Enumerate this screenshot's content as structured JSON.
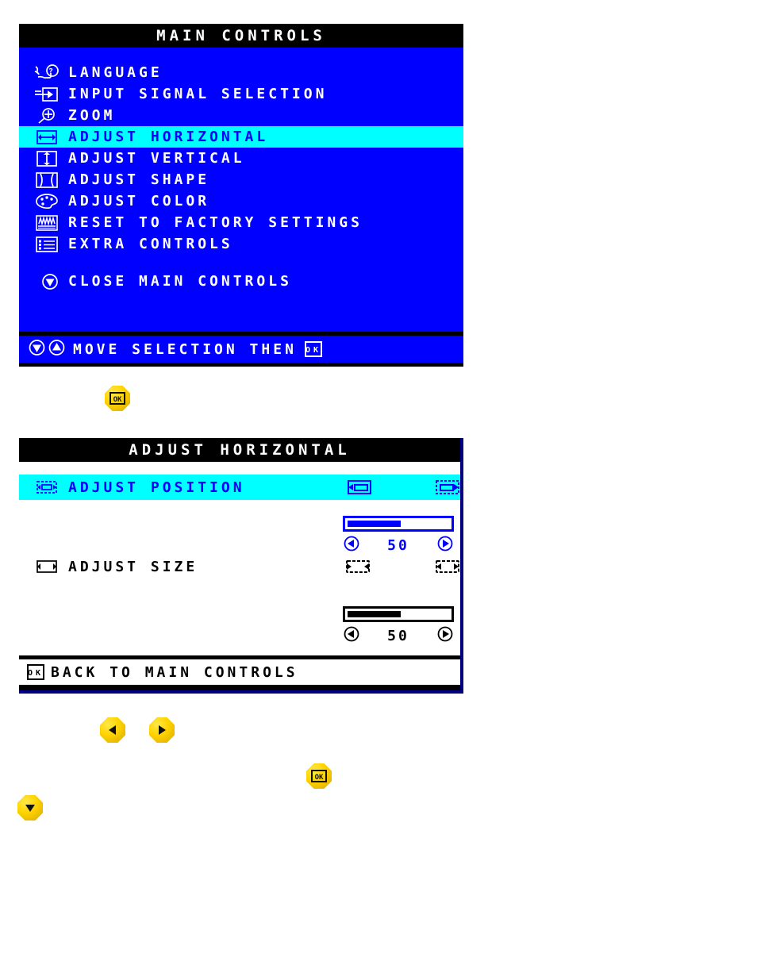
{
  "main_controls": {
    "title": "MAIN CONTROLS",
    "items": [
      {
        "icon": "language-hand-question-icon",
        "label": "LANGUAGE",
        "selected": false
      },
      {
        "icon": "input-signal-arrow-icon",
        "label": "INPUT SIGNAL SELECTION",
        "selected": false
      },
      {
        "icon": "zoom-magnifier-icon",
        "label": "ZOOM",
        "selected": false
      },
      {
        "icon": "adjust-horizontal-icon",
        "label": "ADJUST HORIZONTAL",
        "selected": true
      },
      {
        "icon": "adjust-vertical-icon",
        "label": "ADJUST VERTICAL",
        "selected": false
      },
      {
        "icon": "adjust-shape-icon",
        "label": "ADJUST SHAPE",
        "selected": false
      },
      {
        "icon": "adjust-color-palette-icon",
        "label": "ADJUST COLOR",
        "selected": false
      },
      {
        "icon": "reset-factory-icon",
        "label": "RESET TO FACTORY SETTINGS",
        "selected": false
      },
      {
        "icon": "extra-controls-list-icon",
        "label": "EXTRA CONTROLS",
        "selected": false
      }
    ],
    "close_item": {
      "icon": "down-arrow-circle-icon",
      "label": "CLOSE MAIN CONTROLS"
    },
    "footer": {
      "label": "MOVE SELECTION THEN",
      "icons": [
        "down-arrow-circle-icon",
        "up-arrow-circle-icon"
      ],
      "trailing_icon": "ok-icon"
    }
  },
  "adjust_horizontal": {
    "title": "ADJUST HORIZONTAL",
    "rows": [
      {
        "icon": "adjust-position-icon",
        "label": "ADJUST POSITION",
        "selected": true,
        "left_icon": "shift-left-icon",
        "right_icon": "shift-right-icon",
        "slider": {
          "value": "50",
          "fill_percent": 52,
          "color": "blue"
        },
        "left_step_icon": "left-triangle-icon",
        "right_step_icon": "right-triangle-icon"
      },
      {
        "icon": "adjust-size-icon",
        "label": "ADJUST SIZE",
        "selected": false,
        "left_icon": "shrink-icon",
        "right_icon": "expand-icon",
        "slider": {
          "value": "50",
          "fill_percent": 52,
          "color": "black"
        },
        "left_step_icon": "left-triangle-icon",
        "right_step_icon": "right-triangle-icon"
      }
    ],
    "footer": {
      "icon": "ok-icon",
      "label": "BACK TO MAIN CONTROLS"
    }
  },
  "hardware_buttons": [
    {
      "name": "ok-button-top",
      "glyph": "ok"
    },
    {
      "name": "left-button",
      "glyph": "left"
    },
    {
      "name": "right-button",
      "glyph": "right"
    },
    {
      "name": "ok-button-bottom",
      "glyph": "ok"
    },
    {
      "name": "down-button",
      "glyph": "down"
    }
  ],
  "colors": {
    "osd_blue": "#0000FF",
    "osd_cyan": "#00FFFF",
    "osd_black": "#000000",
    "osd_white": "#FFFFFF",
    "button_yellow": "#FFD400",
    "panel2_border": "#000080"
  }
}
